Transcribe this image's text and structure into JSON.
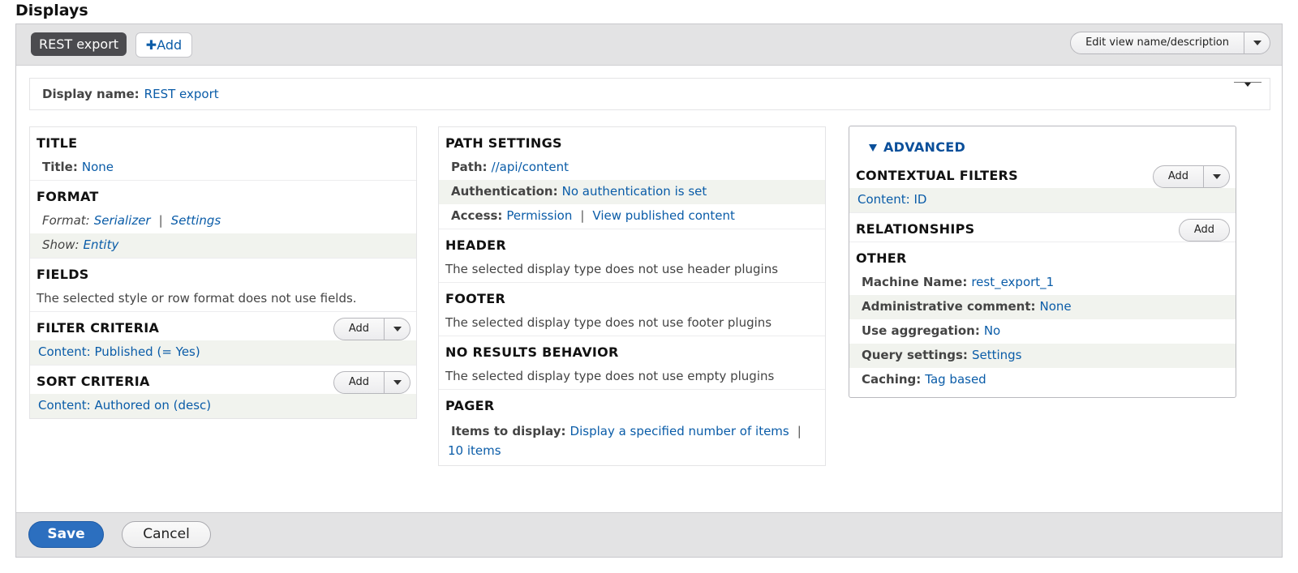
{
  "heading": "Displays",
  "tabs": {
    "active": "REST export",
    "add": "Add",
    "edit_view": "Edit view name/description"
  },
  "display_name": {
    "label": "Display name:",
    "value": "REST export"
  },
  "col1": {
    "title": {
      "heading": "TITLE",
      "label": "Title:",
      "value": "None"
    },
    "format": {
      "heading": "FORMAT",
      "format_label": "Format:",
      "format_value": "Serializer",
      "separator": "|",
      "settings": "Settings",
      "show_label": "Show:",
      "show_value": "Entity"
    },
    "fields": {
      "heading": "FIELDS",
      "text": "The selected style or row format does not use fields."
    },
    "filter": {
      "heading": "FILTER CRITERIA",
      "add": "Add",
      "item": "Content: Published (= Yes)"
    },
    "sort": {
      "heading": "SORT CRITERIA",
      "add": "Add",
      "item": "Content: Authored on (desc)"
    }
  },
  "col2": {
    "path": {
      "heading": "PATH SETTINGS",
      "path_label": "Path:",
      "path_value": "//api/content",
      "auth_label": "Authentication:",
      "auth_value": "No authentication is set",
      "access_label": "Access:",
      "access_value": "Permission",
      "separator": "|",
      "access_detail": "View published content"
    },
    "header": {
      "heading": "HEADER",
      "text": "The selected display type does not use header plugins"
    },
    "footer": {
      "heading": "FOOTER",
      "text": "The selected display type does not use footer plugins"
    },
    "no_results": {
      "heading": "NO RESULTS BEHAVIOR",
      "text": "The selected display type does not use empty plugins"
    },
    "pager": {
      "heading": "PAGER",
      "label": "Items to display:",
      "value": "Display a specified number of items",
      "separator": "|",
      "count": "10 items"
    }
  },
  "col3": {
    "advanced": "ADVANCED",
    "contextual": {
      "heading": "CONTEXTUAL FILTERS",
      "add": "Add",
      "item": "Content: ID"
    },
    "relationships": {
      "heading": "RELATIONSHIPS",
      "add": "Add"
    },
    "other": {
      "heading": "OTHER",
      "machine_label": "Machine Name:",
      "machine_value": "rest_export_1",
      "comment_label": "Administrative comment:",
      "comment_value": "None",
      "aggregation_label": "Use aggregation:",
      "aggregation_value": "No",
      "query_label": "Query settings:",
      "query_value": "Settings",
      "caching_label": "Caching:",
      "caching_value": "Tag based"
    }
  },
  "actions": {
    "save": "Save",
    "cancel": "Cancel"
  },
  "colors": {
    "link": "#0a5ca8",
    "primary_button": "#2c6fbf",
    "active_tab": "#4b4b4f",
    "bar_background": "#e3e3e4",
    "row_shade": "#f1f3ee"
  }
}
